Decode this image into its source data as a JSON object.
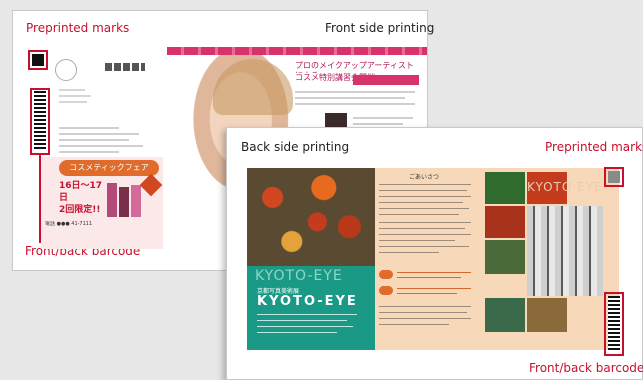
{
  "front": {
    "label_preprinted": "Preprinted marks",
    "label_printing": "Front side printing",
    "label_barcode": "Front/back barcode",
    "ad_red_text": "16日～17日",
    "ad_red_text2": "2回限定!!",
    "ad_banner": "コスメティックフェア",
    "ad_headline": "プロのメイクアップアーティストによる",
    "ad_headline2": "コスメ特別講習会開催",
    "ad_phone": "電話 ●●● 41-7111"
  },
  "back": {
    "label_printing": "Back side printing",
    "label_preprinted": "Preprinted marks",
    "label_barcode": "Front/back barcode",
    "brand_small": "KYOTO-EYE",
    "brand_big": "KYOTO-EYE",
    "brand_sub": "京都写真美術展",
    "watermark": "KYOTO EYE",
    "greeting": "ごあいさつ"
  },
  "colors": {
    "accent_red": "#c8102e",
    "teal": "#1a9a86",
    "orange": "#e06b2a",
    "peach": "#f7d9b9"
  }
}
